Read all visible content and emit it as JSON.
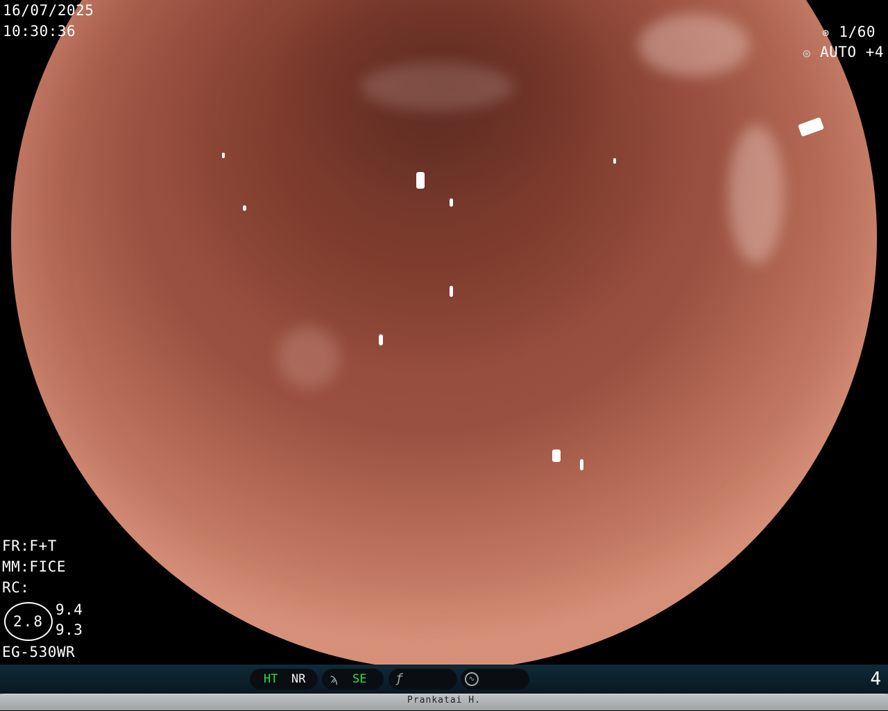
{
  "overlay": {
    "date": "16/07/2025",
    "time": "10:30:36",
    "shutter": "1/60",
    "exposure": "AUTO +4",
    "shutter_icon": "aperture-icon",
    "exposure_icon": "iris-icon",
    "fr": "FR:F+T",
    "mm": "MM:FICE",
    "rc": "RC:",
    "gauge_value": "2.8",
    "gauge_upper": "9.4",
    "gauge_lower": "9.3",
    "scope_model": "EG-530WR"
  },
  "status_bar": {
    "ht": "HT",
    "nr": "NR",
    "se": "SE",
    "se_icon": "structure-enhance-icon",
    "f_icon": "function-icon",
    "wave_icon": "waveform-icon",
    "number": "4",
    "active_color": "#28e04a"
  },
  "footer": {
    "patient_name": "Prankatai H."
  }
}
